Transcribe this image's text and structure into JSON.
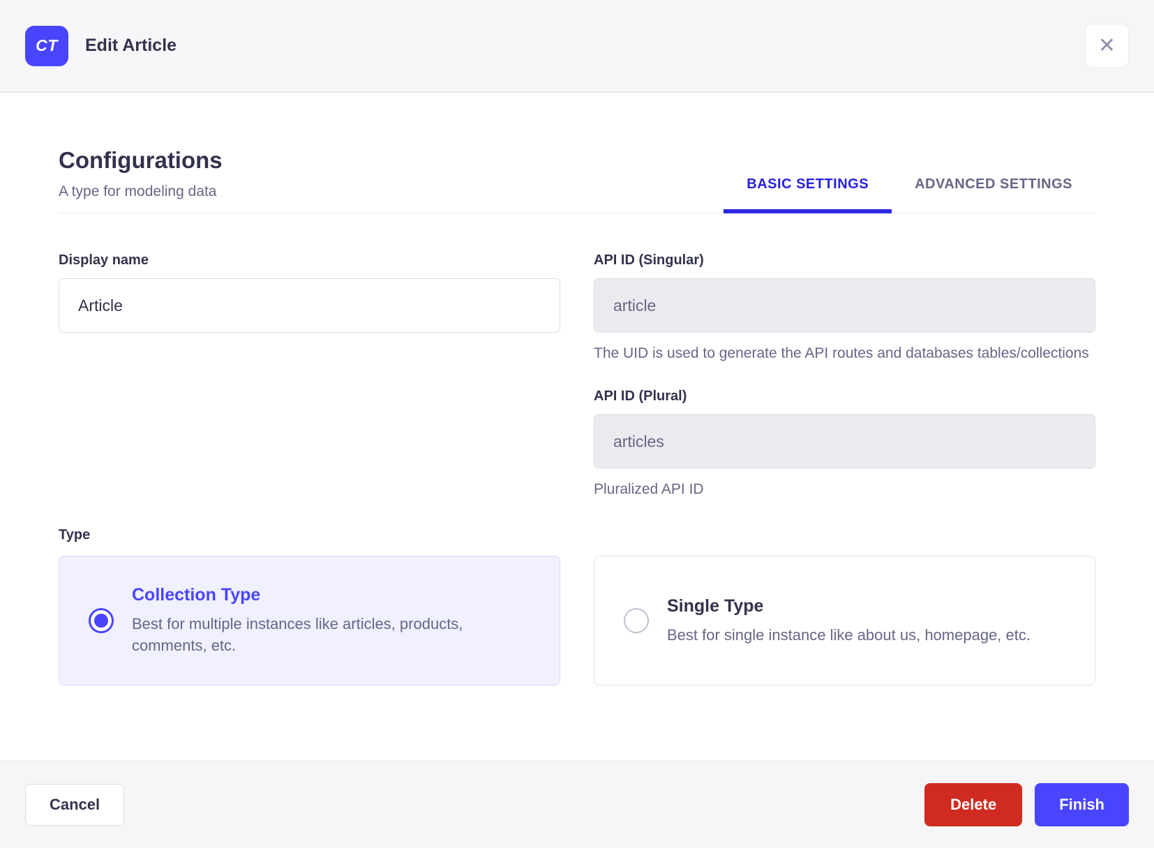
{
  "header": {
    "badge": "CT",
    "title": "Edit Article",
    "close_icon": "✕"
  },
  "configurations": {
    "title": "Configurations",
    "subtitle": "A type for modeling data"
  },
  "tabs": [
    {
      "label": "BASIC SETTINGS",
      "active": true
    },
    {
      "label": "ADVANCED SETTINGS",
      "active": false
    }
  ],
  "form": {
    "display_name": {
      "label": "Display name",
      "value": "Article"
    },
    "api_id_singular": {
      "label": "API ID (Singular)",
      "value": "article",
      "hint": "The UID is used to generate the API routes and databases tables/collections"
    },
    "api_id_plural": {
      "label": "API ID (Plural)",
      "value": "articles",
      "hint": "Pluralized API ID"
    },
    "type": {
      "label": "Type",
      "options": [
        {
          "title": "Collection Type",
          "description": "Best for multiple instances like articles, products, comments, etc.",
          "selected": true
        },
        {
          "title": "Single Type",
          "description": "Best for single instance like about us, homepage, etc.",
          "selected": false
        }
      ]
    }
  },
  "footer": {
    "cancel": "Cancel",
    "delete": "Delete",
    "finish": "Finish"
  },
  "colors": {
    "primary": "#4945ff",
    "tab_active": "#271fe0",
    "danger": "#d02b20",
    "selected_card_bg": "#f0f0ff",
    "text_dark": "#32324d",
    "text_gray": "#666687",
    "surface_gray": "#f6f6f9"
  }
}
